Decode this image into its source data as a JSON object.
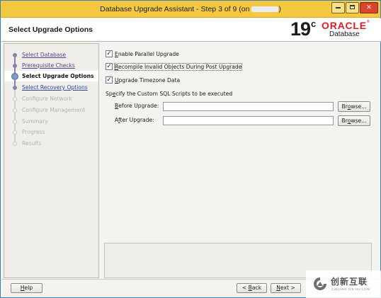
{
  "window": {
    "title_prefix": "Database Upgrade Assistant - Step 3 of 9 (on ",
    "title_suffix": ")"
  },
  "header": {
    "page_title": "Select Upgrade Options",
    "logo_version": "19",
    "logo_version_sup": "c",
    "logo_brand": "ORACLE",
    "logo_product": "Database"
  },
  "steps": [
    {
      "label": "Select Database",
      "state": "done"
    },
    {
      "label": "Prerequisite Checks",
      "state": "done"
    },
    {
      "label": "Select Upgrade Options",
      "state": "current"
    },
    {
      "label": "Select Recovery Options",
      "state": "link"
    },
    {
      "label": "Configure Network",
      "state": "disabled"
    },
    {
      "label": "Configure Management",
      "state": "disabled"
    },
    {
      "label": "Summary",
      "state": "disabled"
    },
    {
      "label": "Progress",
      "state": "disabled"
    },
    {
      "label": "Results",
      "state": "disabled"
    }
  ],
  "options": {
    "parallel": {
      "mnemonic": "E",
      "rest": "nable Parallel Upgrade",
      "checked": true
    },
    "recompile": {
      "mnemonic": "R",
      "rest": "ecompile Invalid Objects During Post Upgrade",
      "checked": true
    },
    "timezone": {
      "mnemonic": "U",
      "rest": "pgrade Timezone Data",
      "checked": true
    }
  },
  "sql_scripts": {
    "title_pre": "Sp",
    "title_mnemonic": "e",
    "title_post": "cify the Custom SQL Scripts to be executed",
    "before_mnemonic": "B",
    "before_rest": "efore Upgrade:",
    "before_value": "",
    "after_pre": "A",
    "after_mnemonic": "f",
    "after_rest": "ter Upgrade:",
    "after_value": "",
    "browse_pre": "Br",
    "browse_mnemonic": "o",
    "browse_post": "wse..."
  },
  "buttons": {
    "help_mnemonic": "H",
    "help_rest": "elp",
    "back_pre": "< ",
    "back_mnemonic": "B",
    "back_rest": "ack",
    "next_mnemonic": "N",
    "next_rest": "ext >"
  },
  "watermark": {
    "cn": "创新互联",
    "en": "CHUANG XIN HU LIAN"
  },
  "colors": {
    "titlebar": "#f5c842",
    "close_button": "#d9442a",
    "oracle_red": "#e21c23",
    "step_done": "#5a3f8a",
    "step_link": "#2b48a8"
  }
}
